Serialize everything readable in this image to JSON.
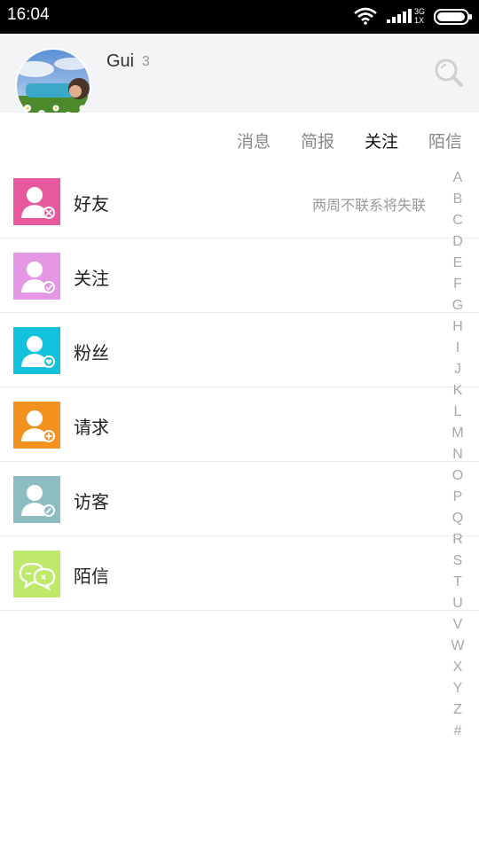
{
  "status_bar": {
    "time": "16:04",
    "network_top": "3G",
    "network_bottom": "1X",
    "icons": [
      "wifi-icon",
      "signal-icon",
      "battery-icon"
    ]
  },
  "profile": {
    "name": "Gui",
    "count": "3",
    "search_icon": "search-icon"
  },
  "tabs": [
    {
      "label": "消息",
      "active": false
    },
    {
      "label": "简报",
      "active": false
    },
    {
      "label": "关注",
      "active": true
    },
    {
      "label": "陌信",
      "active": false
    }
  ],
  "list": [
    {
      "label": "好友",
      "hint": "两周不联系将失联",
      "icon": "friend-icon",
      "color": "#e8589f"
    },
    {
      "label": "关注",
      "hint": "",
      "icon": "follow-icon",
      "color": "#e497e4"
    },
    {
      "label": "粉丝",
      "hint": "",
      "icon": "fans-icon",
      "color": "#13c1dd"
    },
    {
      "label": "请求",
      "hint": "",
      "icon": "request-icon",
      "color": "#f49220"
    },
    {
      "label": "访客",
      "hint": "",
      "icon": "visitor-icon",
      "color": "#8dbcc2"
    },
    {
      "label": "陌信",
      "hint": "",
      "icon": "message-icon",
      "color": "#bfe96a"
    }
  ],
  "alphabet": [
    "A",
    "B",
    "C",
    "D",
    "E",
    "F",
    "G",
    "H",
    "I",
    "J",
    "K",
    "L",
    "M",
    "N",
    "O",
    "P",
    "Q",
    "R",
    "S",
    "T",
    "U",
    "V",
    "W",
    "X",
    "Y",
    "Z",
    "#"
  ]
}
